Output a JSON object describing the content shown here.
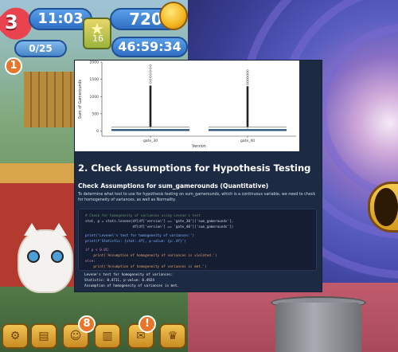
{
  "hud": {
    "lives": "3",
    "lives_timer": "11:03",
    "coins": "720",
    "level": "16",
    "goals": "0/25",
    "event_timer": "46:59:34",
    "inbox_badge": "1",
    "bottom_badge_left": "8",
    "bottom_badge_right": "!"
  },
  "toolbar": {
    "settings_icon": "gear-icon",
    "shop_icon": "chest-icon",
    "team_icon": "team-icon",
    "leaderboard_icon": "leaderboard-icon",
    "events_icon": "gift-icon",
    "season_icon": "trophy-icon"
  },
  "notebook": {
    "heading": "2. Check Assumptions for Hypothesis Testing",
    "subheading": "Check Assumptions for sum_gamerounds (Quantitative)",
    "paragraph": "To determine what test to use for hypothesis testing on sum_gamerounds, which is a continuous variable, we need to check for homogeneity of variances, as well as Normality.",
    "code": {
      "line1": "# Check for homogeneity of variances using Levene's test",
      "line2": "stat, p = stats.levene(df[df['version'] == 'gate_30']['sum_gamerounds'],",
      "line3": "                       df[df['version'] == 'gate_40']['sum_gamerounds'])",
      "line4": "print('Levene\\'s test for homogeneity of variances:')",
      "line5": "print(f'Statistic: {stat:.4f}, p-value: {p:.4f}')",
      "line6": "if p < 0.05:",
      "line7": "    print('Assumption of homogeneity of variances is violated.')",
      "line8": "else:",
      "line9": "    print('Assumption of homogeneity of variances is met.')"
    },
    "output": {
      "line1": "Levene's test for homogeneity of variances:",
      "line2": "Statistic: 0.4711, p-value: 0.4924",
      "line3": "Assumption of homogeneity of variances is met."
    }
  },
  "chart_data": {
    "type": "box",
    "categories": [
      "gate_30",
      "gate_40"
    ],
    "xlabel": "Version",
    "ylabel": "Sum of Gamerounds",
    "yticks": [
      0,
      500,
      1000,
      1500,
      2000
    ],
    "ylim": [
      -150,
      2000
    ],
    "boxes": [
      {
        "name": "gate_30",
        "q1": 5,
        "median": 17,
        "q3": 52,
        "whisker_high": 120,
        "outlier_max": 1900,
        "dense_outliers_to": 1320
      },
      {
        "name": "gate_40",
        "q1": 5,
        "median": 16,
        "q3": 51,
        "whisker_high": 118,
        "outlier_max": 1750,
        "dense_outliers_to": 1300
      }
    ],
    "grid": false,
    "box_color": "#3b6f9e"
  }
}
